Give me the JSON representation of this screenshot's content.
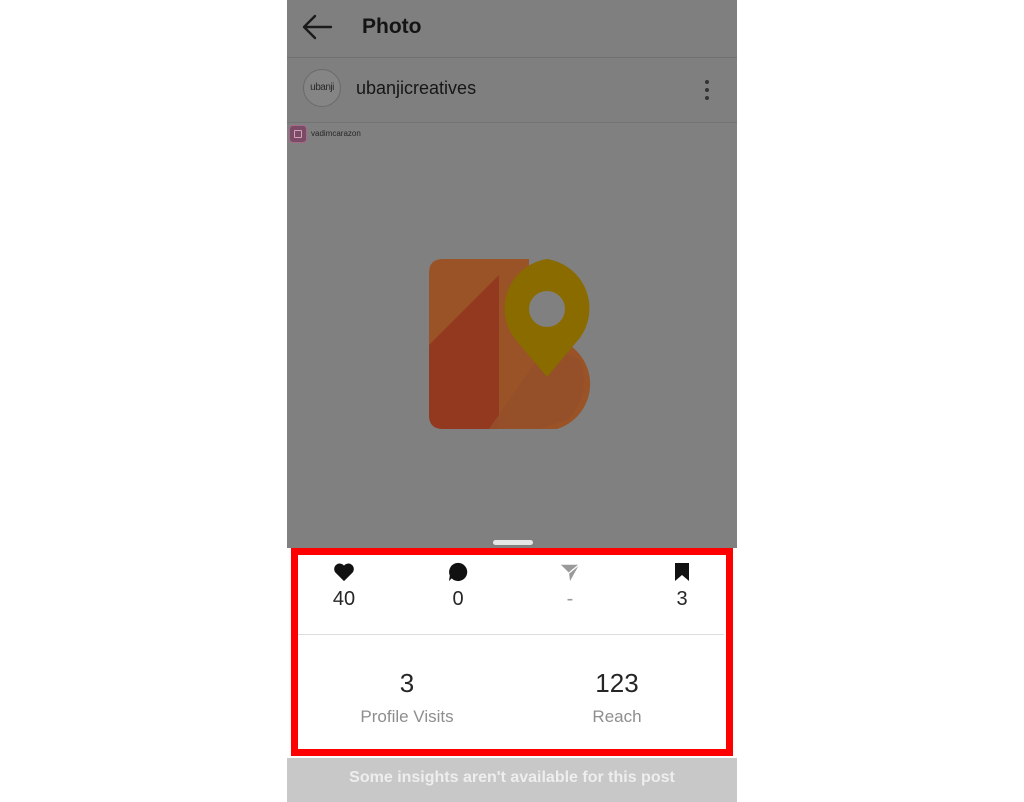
{
  "header": {
    "title": "Photo"
  },
  "post": {
    "username": "ubanjicreatives",
    "avatar_text": "ubanji",
    "watermark_text": "vadimcarazon"
  },
  "stats": [
    {
      "icon": "heart-icon",
      "value": "40"
    },
    {
      "icon": "comment-icon",
      "value": "0"
    },
    {
      "icon": "share-icon",
      "value": "-"
    },
    {
      "icon": "bookmark-icon",
      "value": "3"
    }
  ],
  "metrics": [
    {
      "value": "3",
      "label": "Profile Visits"
    },
    {
      "value": "123",
      "label": "Reach"
    }
  ],
  "footer_note": "Some insights aren't available for this post",
  "colors": {
    "highlight": "#ff0000",
    "overlay": "#7f7f7f"
  }
}
